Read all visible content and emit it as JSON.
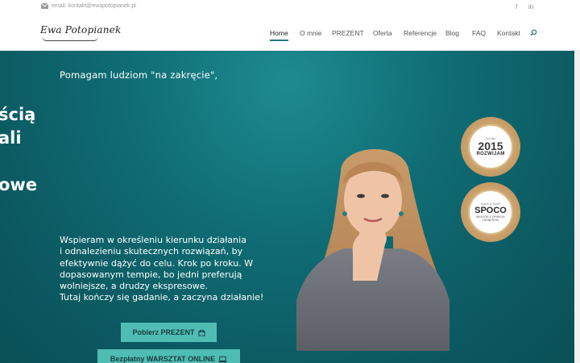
{
  "topbar": {
    "email": "email: kontakt@ewapotopianek.pl",
    "facebook": "f",
    "linkedin": "in"
  },
  "logo": {
    "text": "Ewa Potopianek"
  },
  "nav": {
    "items": [
      {
        "label": "Home",
        "active": true
      },
      {
        "label": "O mnie"
      },
      {
        "label": "PREZENT"
      },
      {
        "label": "Oferta"
      },
      {
        "label": "Referencje"
      },
      {
        "label": "Blog"
      },
      {
        "label": "FAQ"
      },
      {
        "label": "Kontakt"
      }
    ],
    "search_icon": "search-icon"
  },
  "hero": {
    "tagline": "Pomagam ludziom \"na zakręcie\",",
    "big_lines": [
      "ścią",
      "ali",
      "owe"
    ],
    "description": [
      "Wspieram w określeniu kierunku działania",
      "i odnalezieniu skutecznych rozwiązań, by",
      "efektywnie dążyć do celu. Krok po kroku. W",
      "dopasowanym tempie, bo jedni preferują",
      "wolniejsze, a drudzy ekspresowe.",
      "Tutaj kończy się gadanie, a zaczyna działanie!"
    ],
    "button1": {
      "label": "Pobierz PREZENT",
      "icon": "gift-icon"
    },
    "button2": {
      "label": "Bezpłatny WARSZTAT ONLINE",
      "icon": "laptop-icon"
    }
  },
  "badges": {
    "badge1": {
      "top": "Od roku",
      "year": "2015",
      "main": "ROZWIJAM"
    },
    "badge2": {
      "top": "Coach & Trener",
      "main": "SPOCO",
      "sub": "MENTOR & OPIEKUN TRENERÓW"
    }
  },
  "colors": {
    "accent": "#1f7a80",
    "hero_bg": "#0f6c74",
    "button": "#4fbdb4"
  }
}
